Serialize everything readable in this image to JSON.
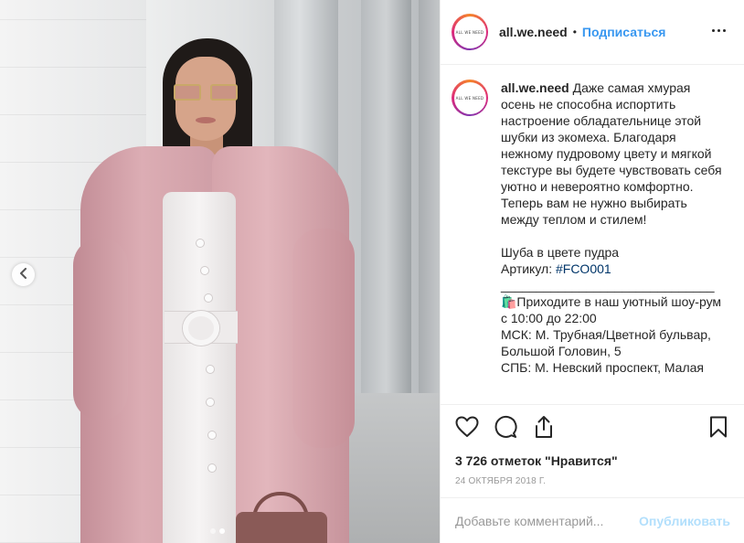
{
  "post": {
    "username": "all.we.need",
    "avatar_text": "ALL WE NEED",
    "follow_label": "Подписаться",
    "separator": "•",
    "caption_lines": [
      "Даже самая хмурая",
      "осень не способна испортить",
      "настроение обладательнице этой",
      "шубки из экомеха. Благодаря",
      "нежному пудровому цвету и мягкой",
      "текстуре вы будете чувствовать себя",
      "уютно и невероятно комфортно.",
      "Теперь вам не нужно выбирать",
      "между теплом и стилем!",
      "",
      "Шуба в цвете пудра"
    ],
    "article_label": "Артикул:",
    "hashtag": "#FCO001",
    "divider_line": "______________________________",
    "info_lines": [
      "🛍️Приходите в наш уютный шоу-рум",
      "с 10:00 до 22:00",
      "МСК: М. Трубная/Цветной бульвар,",
      "Большой Головин, 5",
      "СПБ: М. Невский проспект, Малая"
    ],
    "likes_text": "3 726 отметок \"Нравится\"",
    "date_text": "24 октября 2018 г."
  },
  "comment_box": {
    "placeholder": "Добавьте комментарий...",
    "publish_label": "Опубликовать"
  },
  "carousel": {
    "dot_count": 2,
    "active_dot": 1
  },
  "colors": {
    "link_blue": "#3897f0",
    "hashtag_blue": "#003569",
    "publish_disabled": "#b2dffc",
    "coat_pink": "#d8a7ae"
  },
  "icons": {
    "prev": "chevron-left-icon",
    "like": "heart-icon",
    "comment": "comment-bubble-icon",
    "share": "share-icon",
    "save": "bookmark-icon",
    "more": "more-options-icon"
  }
}
